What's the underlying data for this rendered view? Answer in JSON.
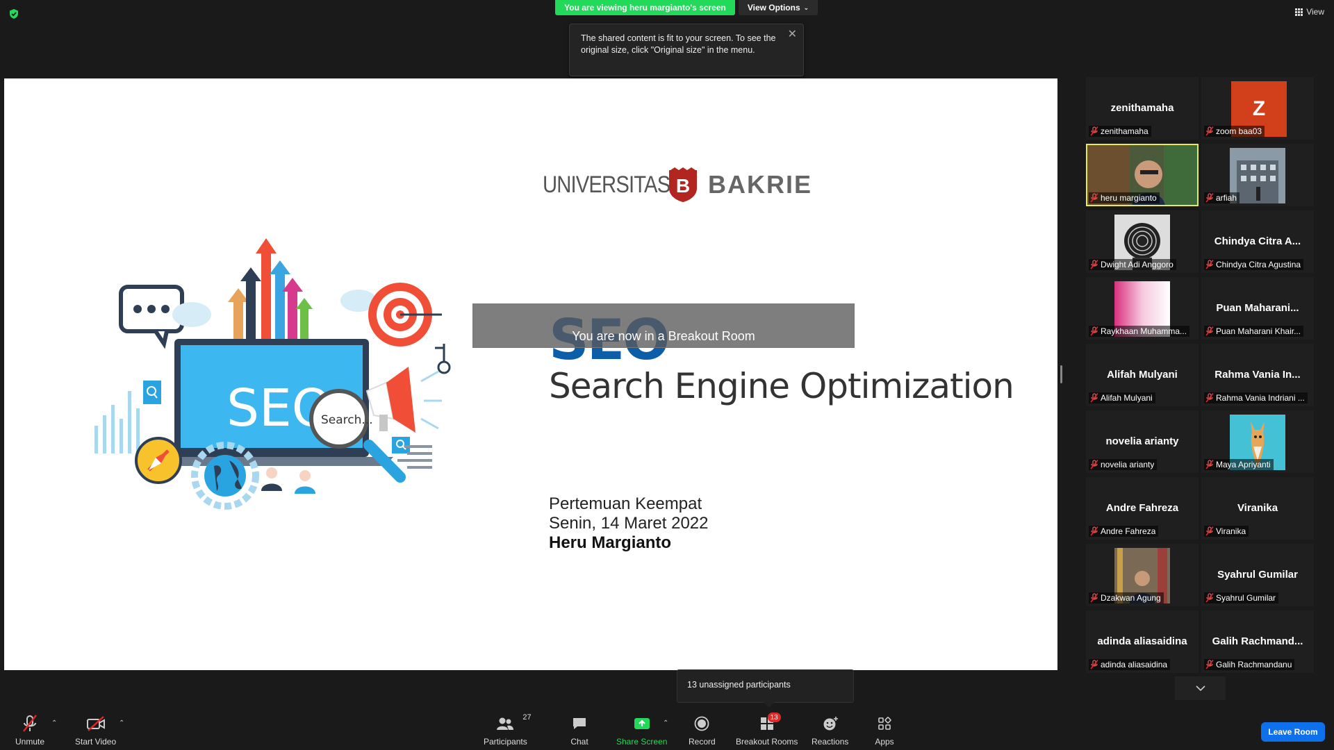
{
  "top": {
    "viewing_banner": "You are viewing heru margianto's screen",
    "view_options": "View Options",
    "view_toggle": "View",
    "tooltip": "The shared content is fit to your screen. To see the original size, click \"Original size\" in the menu."
  },
  "slide": {
    "logo_left": "UNIVERSITAS",
    "logo_mark": "B",
    "logo_right": "BAKRIE",
    "seo_title": "SEO",
    "seo_subtitle": "Search Engine Optimization",
    "laptop_text": "SEO",
    "search_text": "Search...",
    "meeting_line1": "Pertemuan Keempat",
    "meeting_line2": "Senin, 14 Maret 2022",
    "presenter": "Heru Margianto"
  },
  "breakout_notice": "You are now in a Breakout Room",
  "gallery": [
    {
      "display": "zenithamaha",
      "label": "zenithamaha",
      "kind": "name"
    },
    {
      "display": "Z",
      "label": "zoom baa03",
      "kind": "letter",
      "color": "#d2401b"
    },
    {
      "display": "",
      "label": "heru margianto",
      "kind": "video",
      "active": true
    },
    {
      "display": "",
      "label": "arfiah",
      "kind": "photo-building"
    },
    {
      "display": "",
      "label": "Dwight Adi Anggoro",
      "kind": "photo-fingerprint"
    },
    {
      "display": "Chindya Citra A...",
      "label": "Chindya Citra Agustina",
      "kind": "name"
    },
    {
      "display": "",
      "label": "Raykhaan Muhamma...",
      "kind": "photo-pink"
    },
    {
      "display": "Puan  Maharani...",
      "label": "Puan Maharani Khair...",
      "kind": "name"
    },
    {
      "display": "Alifah Mulyani",
      "label": "Alifah Mulyani",
      "kind": "name"
    },
    {
      "display": "Rahma Vania In...",
      "label": "Rahma Vania Indriani ...",
      "kind": "name"
    },
    {
      "display": "novelia arianty",
      "label": "novelia arianty",
      "kind": "name"
    },
    {
      "display": "",
      "label": "Maya Apriyanti",
      "kind": "photo-giraffe"
    },
    {
      "display": "Andre Fahreza",
      "label": "Andre Fahreza",
      "kind": "name"
    },
    {
      "display": "Viranika",
      "label": "Viranika",
      "kind": "name"
    },
    {
      "display": "",
      "label": "Dzakwan Agung",
      "kind": "photo-person"
    },
    {
      "display": "Syahrul Gumilar",
      "label": "Syahrul Gumilar",
      "kind": "name"
    },
    {
      "display": "adinda aliasaidina",
      "label": "adinda aliasaidina",
      "kind": "name"
    },
    {
      "display": "Galih  Rachmand...",
      "label": "Galih Rachmandanu",
      "kind": "name"
    }
  ],
  "unassigned": "13 unassigned participants",
  "toolbar": {
    "unmute": "Unmute",
    "start_video": "Start Video",
    "participants": "Participants",
    "participants_count": "27",
    "chat": "Chat",
    "share_screen": "Share Screen",
    "record": "Record",
    "breakout_rooms": "Breakout Rooms",
    "breakout_badge": "13",
    "reactions": "Reactions",
    "apps": "Apps",
    "leave_room": "Leave Room"
  },
  "colors": {
    "banner_green": "#23d959",
    "leave_blue": "#0e71eb",
    "active_border": "#e9e961",
    "badge_red": "#e02828",
    "seo_blue": "#0d5ea8"
  }
}
